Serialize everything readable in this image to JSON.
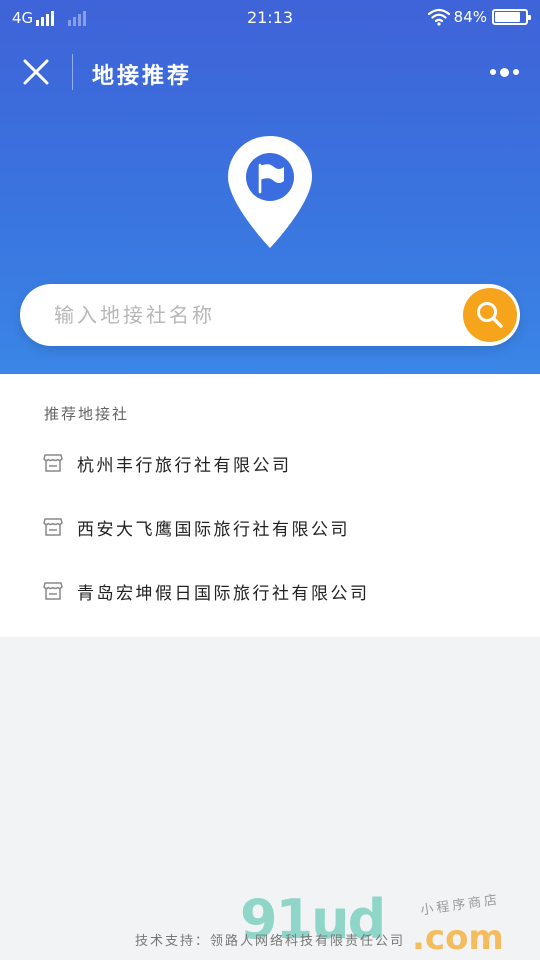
{
  "status_bar": {
    "network": "4G",
    "time": "21:13",
    "battery": "84%",
    "battery_level": 0.84
  },
  "header": {
    "title": "地接推荐",
    "close_icon": "close-icon",
    "more_icon": "more-dots-icon"
  },
  "hero": {
    "icon": "location-pin-flag-icon"
  },
  "search": {
    "placeholder": "输入地接社名称",
    "value": "",
    "button_icon": "search-icon"
  },
  "recommend": {
    "section_title": "推荐地接社",
    "items": [
      {
        "name": "杭州丰行旅行社有限公司",
        "icon": "shop-icon"
      },
      {
        "name": "西安大飞鹰国际旅行社有限公司",
        "icon": "shop-icon"
      },
      {
        "name": "青岛宏坤假日国际旅行社有限公司",
        "icon": "shop-icon"
      }
    ]
  },
  "footer": {
    "credit": "技术支持：领路人网络科技有限责任公司"
  },
  "watermark": {
    "logo": "91ud",
    "domain": ".com",
    "caption": "小程序商店"
  },
  "colors": {
    "header_gradient_top": "#3f63d8",
    "header_gradient_bottom": "#3a86e6",
    "search_button": "#f7a41d",
    "page_background": "#f1f3f4"
  }
}
